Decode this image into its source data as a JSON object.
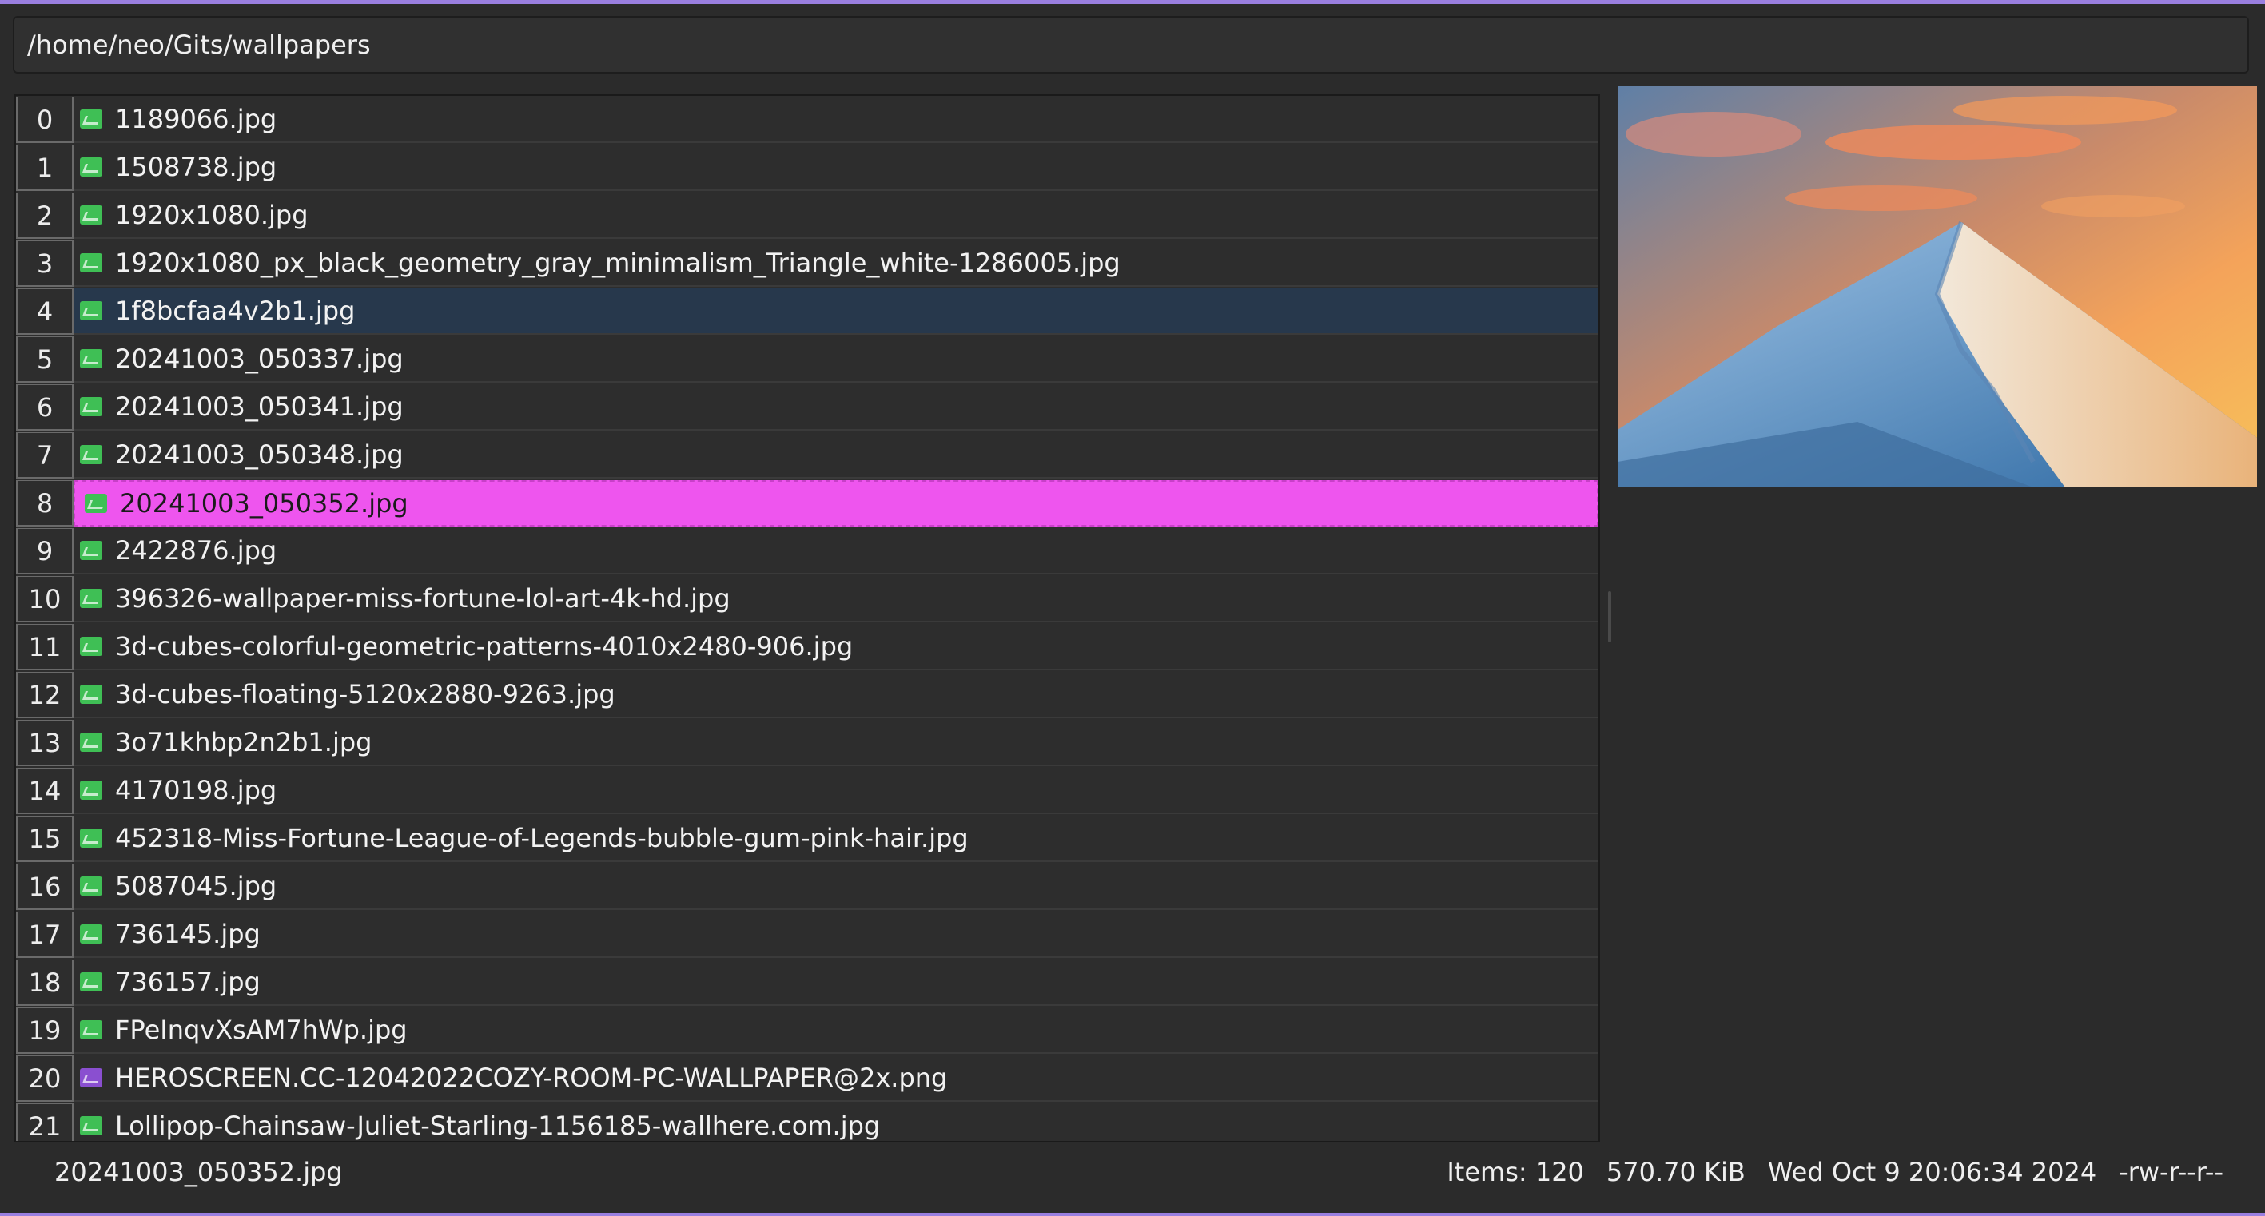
{
  "path_bar": {
    "path": "/home/neo/Gits/wallpapers"
  },
  "files": [
    {
      "index": "0",
      "name": "1189066.jpg",
      "type": "jpg"
    },
    {
      "index": "1",
      "name": "1508738.jpg",
      "type": "jpg"
    },
    {
      "index": "2",
      "name": "1920x1080.jpg",
      "type": "jpg"
    },
    {
      "index": "3",
      "name": "1920x1080_px_black_geometry_gray_minimalism_Triangle_white-1286005.jpg",
      "type": "jpg"
    },
    {
      "index": "4",
      "name": "1f8bcfaa4v2b1.jpg",
      "type": "jpg",
      "state": "hover"
    },
    {
      "index": "5",
      "name": "20241003_050337.jpg",
      "type": "jpg"
    },
    {
      "index": "6",
      "name": "20241003_050341.jpg",
      "type": "jpg"
    },
    {
      "index": "7",
      "name": "20241003_050348.jpg",
      "type": "jpg"
    },
    {
      "index": "8",
      "name": "20241003_050352.jpg",
      "type": "jpg",
      "state": "selected"
    },
    {
      "index": "9",
      "name": "2422876.jpg",
      "type": "jpg"
    },
    {
      "index": "10",
      "name": "396326-wallpaper-miss-fortune-lol-art-4k-hd.jpg",
      "type": "jpg"
    },
    {
      "index": "11",
      "name": "3d-cubes-colorful-geometric-patterns-4010x2480-906.jpg",
      "type": "jpg"
    },
    {
      "index": "12",
      "name": "3d-cubes-floating-5120x2880-9263.jpg",
      "type": "jpg"
    },
    {
      "index": "13",
      "name": "3o71khbp2n2b1.jpg",
      "type": "jpg"
    },
    {
      "index": "14",
      "name": "4170198.jpg",
      "type": "jpg"
    },
    {
      "index": "15",
      "name": "452318-Miss-Fortune-League-of-Legends-bubble-gum-pink-hair.jpg",
      "type": "jpg"
    },
    {
      "index": "16",
      "name": "5087045.jpg",
      "type": "jpg"
    },
    {
      "index": "17",
      "name": "736145.jpg",
      "type": "jpg"
    },
    {
      "index": "18",
      "name": "736157.jpg",
      "type": "jpg"
    },
    {
      "index": "19",
      "name": "FPeInqvXsAM7hWp.jpg",
      "type": "jpg"
    },
    {
      "index": "20",
      "name": "HEROSCREEN.CC-12042022COZY-ROOM-PC-WALLPAPER@2x.png",
      "type": "png"
    },
    {
      "index": "21",
      "name": "Lollipop-Chainsaw-Juliet-Starling-1156185-wallhere.com.jpg",
      "type": "jpg"
    }
  ],
  "status_bar": {
    "selected_name": "20241003_050352.jpg",
    "items": "Items:  120",
    "size": "570.70 KiB",
    "modified": "Wed Oct 9 20:06:34 2024",
    "permissions": "-rw-r--r--"
  },
  "colors": {
    "accent_border": "#9a7fe0",
    "selection": "#ee55ee",
    "hover": "#27384c",
    "jpg_icon": "#3fbf55",
    "png_icon": "#8a4fd0"
  },
  "preview": {
    "image": "image-preview"
  }
}
